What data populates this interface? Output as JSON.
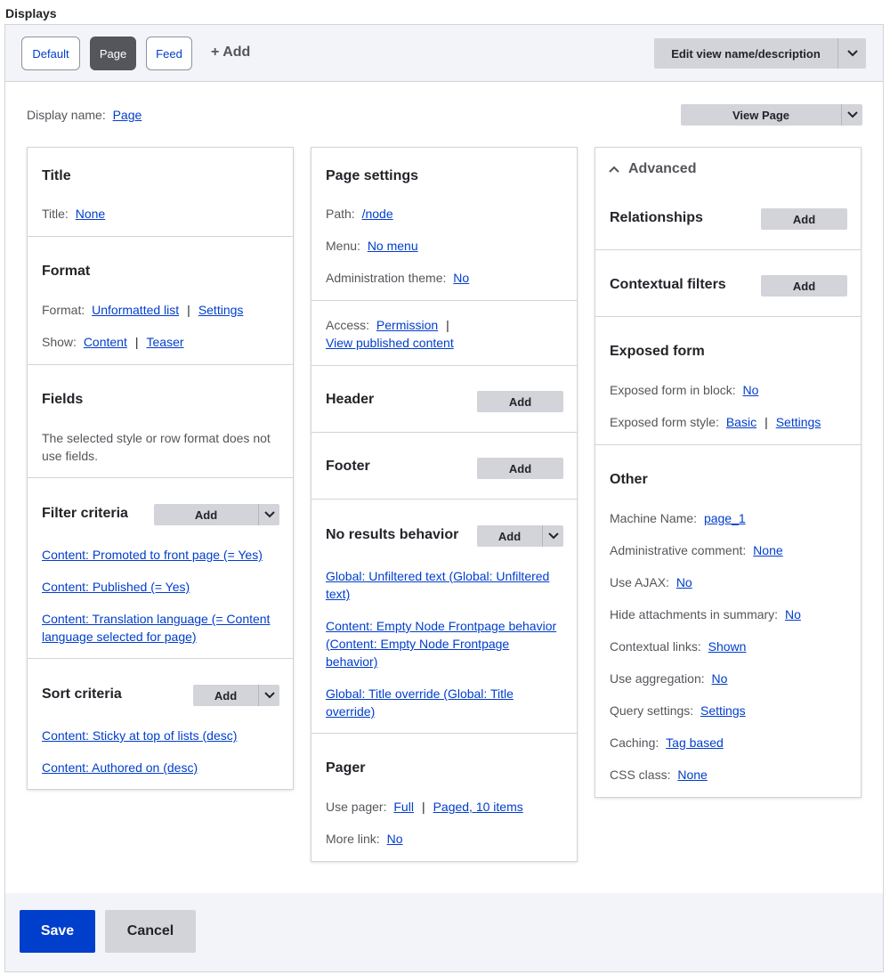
{
  "heading": "Displays",
  "tabs": {
    "default": "Default",
    "page": "Page",
    "feed": "Feed",
    "add": "+ Add"
  },
  "edit_view": "Edit view name/description",
  "display_name": {
    "label": "Display name:",
    "value": "Page"
  },
  "view_page": "View Page",
  "col1": {
    "title": {
      "heading": "Title",
      "label": "Title:",
      "value": "None"
    },
    "format": {
      "heading": "Format",
      "format_label": "Format:",
      "format_value": "Unformatted list",
      "settings": "Settings",
      "show_label": "Show:",
      "show_value": "Content",
      "teaser": "Teaser"
    },
    "fields": {
      "heading": "Fields",
      "text": "The selected style or row format does not use fields."
    },
    "filter": {
      "heading": "Filter criteria",
      "add": "Add",
      "items": [
        "Content: Promoted to front page (= Yes)",
        "Content: Published (= Yes)",
        "Content: Translation language (= Content language selected for page)"
      ]
    },
    "sort": {
      "heading": "Sort criteria",
      "add": "Add",
      "items": [
        "Content: Sticky at top of lists (desc)",
        "Content: Authored on (desc)"
      ]
    }
  },
  "col2": {
    "page_settings": {
      "heading": "Page settings",
      "path_label": "Path:",
      "path_value": "/node",
      "menu_label": "Menu:",
      "menu_value": "No menu",
      "admin_label": "Administration theme:",
      "admin_value": "No"
    },
    "access": {
      "label": "Access:",
      "value": "Permission",
      "value2": "View published content"
    },
    "header": {
      "heading": "Header",
      "add": "Add"
    },
    "footer": {
      "heading": "Footer",
      "add": "Add"
    },
    "no_results": {
      "heading": "No results behavior",
      "add": "Add",
      "items": [
        "Global: Unfiltered text (Global: Unfiltered text)",
        "Content: Empty Node Frontpage behavior (Content: Empty Node Frontpage behavior)",
        "Global: Title override (Global: Title override)"
      ]
    },
    "pager": {
      "heading": "Pager",
      "use_label": "Use pager:",
      "use_value": "Full",
      "use_value2": "Paged, 10 items",
      "more_label": "More link:",
      "more_value": "No"
    }
  },
  "col3": {
    "advanced": "Advanced",
    "relationships": {
      "heading": "Relationships",
      "add": "Add"
    },
    "contextual": {
      "heading": "Contextual filters",
      "add": "Add"
    },
    "exposed": {
      "heading": "Exposed form",
      "block_label": "Exposed form in block:",
      "block_value": "No",
      "style_label": "Exposed form style:",
      "style_value": "Basic",
      "settings": "Settings"
    },
    "other": {
      "heading": "Other",
      "rows": [
        {
          "label": "Machine Name:",
          "value": "page_1"
        },
        {
          "label": "Administrative comment:",
          "value": "None"
        },
        {
          "label": "Use AJAX:",
          "value": "No"
        },
        {
          "label": "Hide attachments in summary:",
          "value": "No"
        },
        {
          "label": "Contextual links:",
          "value": "Shown"
        },
        {
          "label": "Use aggregation:",
          "value": "No"
        },
        {
          "label": "Query settings:",
          "value": "Settings"
        },
        {
          "label": "Caching:",
          "value": "Tag based"
        },
        {
          "label": "CSS class:",
          "value": "None"
        }
      ]
    }
  },
  "actions": {
    "save": "Save",
    "cancel": "Cancel"
  }
}
